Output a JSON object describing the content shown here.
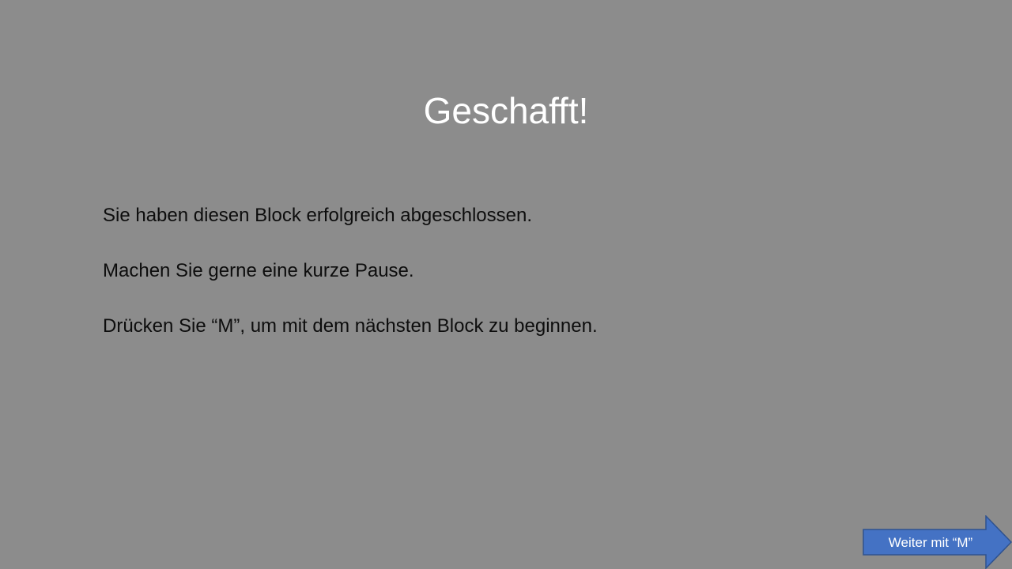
{
  "slide": {
    "title": "Geschafft!",
    "lines": [
      "Sie haben diesen Block erfolgreich abgeschlossen.",
      "Machen Sie gerne eine kurze Pause.",
      "Drücken Sie “M”, um mit dem nächsten Block zu beginnen."
    ]
  },
  "next_button": {
    "label": "Weiter mit “M”",
    "icon": "right-arrow-icon",
    "fill_color": "#4472c4",
    "border_color": "#2f528f"
  },
  "colors": {
    "background": "#8c8c8c",
    "title": "#ffffff",
    "body_text": "#0d0d0d"
  }
}
